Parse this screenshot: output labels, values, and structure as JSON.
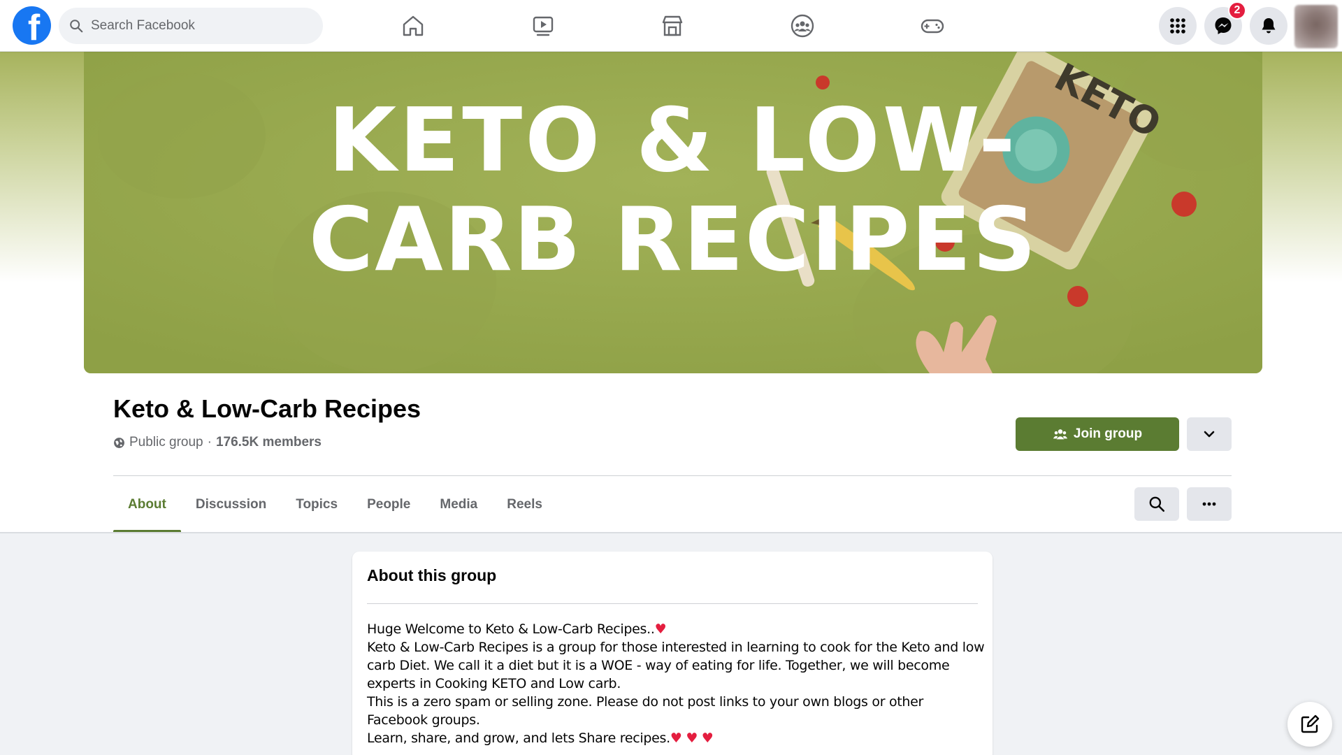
{
  "topbar": {
    "search_placeholder": "Search Facebook",
    "logo_letter": "f",
    "nav_icons": [
      "home-icon",
      "watch-icon",
      "marketplace-icon",
      "groups-icon",
      "gaming-icon"
    ],
    "right_icons": [
      "menu-grid-icon",
      "messenger-icon",
      "notifications-icon"
    ],
    "messenger_badge": "2",
    "brand_color": "#1877f2"
  },
  "cover": {
    "line1": "KETO & LOW-",
    "line2": "CARB RECIPES",
    "package_label": "KETO",
    "background_color": "#9aab4f"
  },
  "group": {
    "name": "Keto & Low-Carb Recipes",
    "privacy": "Public group",
    "separator": " · ",
    "members": "176.5K members",
    "join_label": "Join group",
    "accent_color": "#5b7c32"
  },
  "tabs": [
    {
      "label": "About",
      "active": true
    },
    {
      "label": "Discussion"
    },
    {
      "label": "Topics"
    },
    {
      "label": "People"
    },
    {
      "label": "Media"
    },
    {
      "label": "Reels"
    }
  ],
  "about": {
    "title": "About this group",
    "paragraphs": [
      "Huge Welcome to Keto & Low-Carb Recipes..",
      "Keto & Low-Carb Recipes is a group for those interested in learning to cook for the Keto and low carb Diet. We call it a diet but it is a WOE - way of eating for life. Together, we will become experts in Cooking KETO and Low carb.",
      "This is a zero spam or selling zone. Please do not post links to your own blogs or other Facebook groups.",
      "Learn, share, and grow, and lets Share recipes."
    ],
    "heart": "♥"
  }
}
